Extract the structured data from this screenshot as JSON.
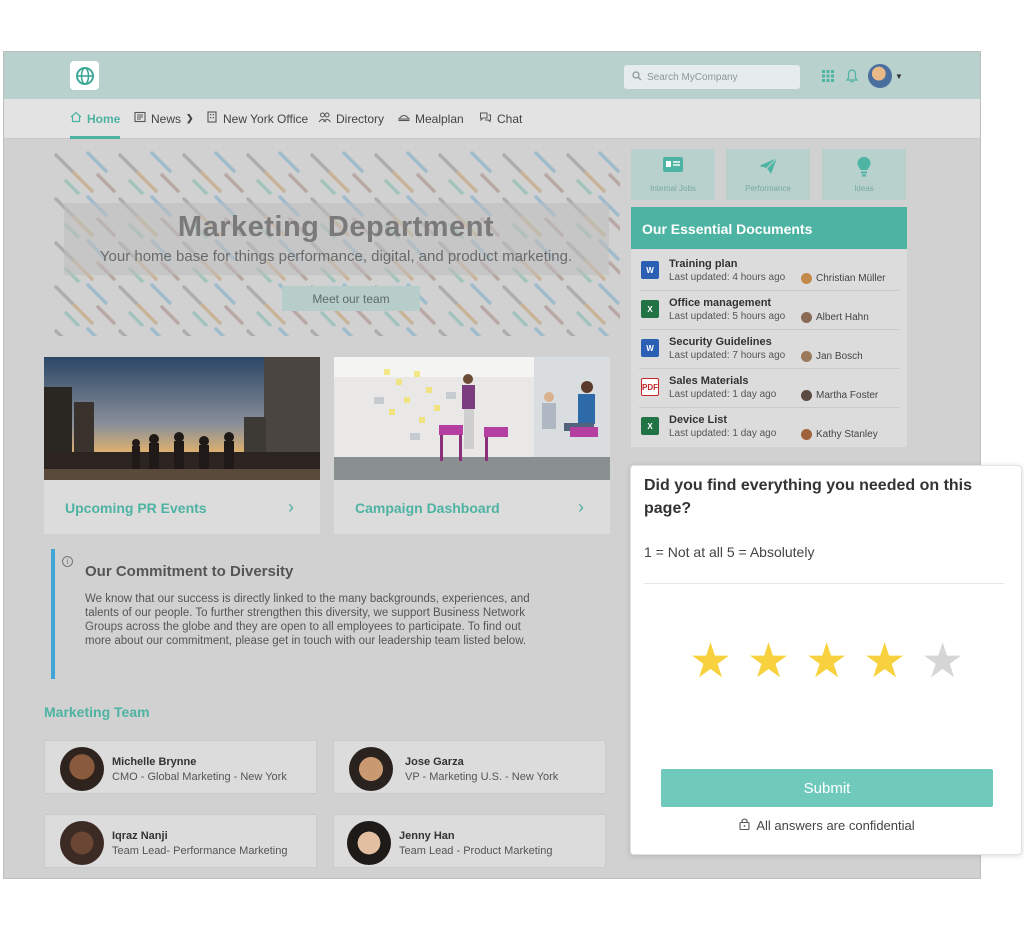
{
  "header": {
    "search_placeholder": "Search MyCompany",
    "icons": [
      "globe-icon",
      "search-icon",
      "apps-grid-icon",
      "bell-icon",
      "avatar"
    ]
  },
  "nav": {
    "items": [
      {
        "label": "Home",
        "icon": "home-icon",
        "active": true
      },
      {
        "label": "News",
        "icon": "newspaper-icon",
        "dropdown": true
      },
      {
        "label": "New York Office",
        "icon": "building-icon"
      },
      {
        "label": "Directory",
        "icon": "people-icon"
      },
      {
        "label": "Mealplan",
        "icon": "meal-icon"
      },
      {
        "label": "Chat",
        "icon": "chat-icon"
      }
    ]
  },
  "hero": {
    "title": "Marketing Department",
    "subtitle": "Your home base for things performance, digital, and product marketing.",
    "button": "Meet our team"
  },
  "cards": [
    {
      "title": "Upcoming PR Events"
    },
    {
      "title": "Campaign Dashboard"
    }
  ],
  "diversity": {
    "title": "Our Commitment to Diversity",
    "text": "We know that our success is directly linked to the many backgrounds, experiences, and talents of our people. To further strengthen this diversity, we support Business Network Groups across the globe and they are open to all employees to participate. To find out more about our commitment, please get in touch with our leadership team listed below."
  },
  "team": {
    "title": "Marketing Team",
    "members": [
      {
        "name": "Michelle Brynne",
        "role": "CMO - Global Marketing - New York"
      },
      {
        "name": "Jose Garza",
        "role": "VP - Marketing U.S. - New York"
      },
      {
        "name": "Iqraz Nanji",
        "role": "Team Lead- Performance Marketing"
      },
      {
        "name": "Jenny Han",
        "role": "Team Lead - Product Marketing"
      }
    ]
  },
  "quicklinks": [
    {
      "label": "Internal Jobs",
      "icon": "id-card-icon"
    },
    {
      "label": "Performance",
      "icon": "paper-plane-icon"
    },
    {
      "label": "Ideas",
      "icon": "lightbulb-icon"
    }
  ],
  "documents": {
    "title": "Our Essential Documents",
    "items": [
      {
        "name": "Training plan",
        "updated": "Last updated: 4 hours ago",
        "author": "Christian Müller",
        "type": "word"
      },
      {
        "name": "Office management",
        "updated": "Last updated: 5 hours ago",
        "author": "Albert Hahn",
        "type": "excel"
      },
      {
        "name": "Security Guidelines",
        "updated": "Last updated: 7 hours ago",
        "author": "Jan Bosch",
        "type": "word"
      },
      {
        "name": "Sales Materials",
        "updated": "Last updated: 1 day ago",
        "author": "Martha Foster",
        "type": "pdf"
      },
      {
        "name": "Device List",
        "updated": "Last updated: 1 day ago",
        "author": "Kathy Stanley",
        "type": "excel"
      }
    ]
  },
  "survey": {
    "question": "Did you find everything you needed on this page?",
    "scale": "1 = Not at all 5 = Absolutely",
    "rating": 4,
    "max_rating": 5,
    "submit": "Submit",
    "confidential": "All answers are confidential"
  },
  "colors": {
    "accent": "#4db3a3",
    "topbar": "#b8d1cd",
    "star_on": "#f7d23e",
    "star_off": "#d6d6d6",
    "info_bar": "#41a5d8"
  }
}
